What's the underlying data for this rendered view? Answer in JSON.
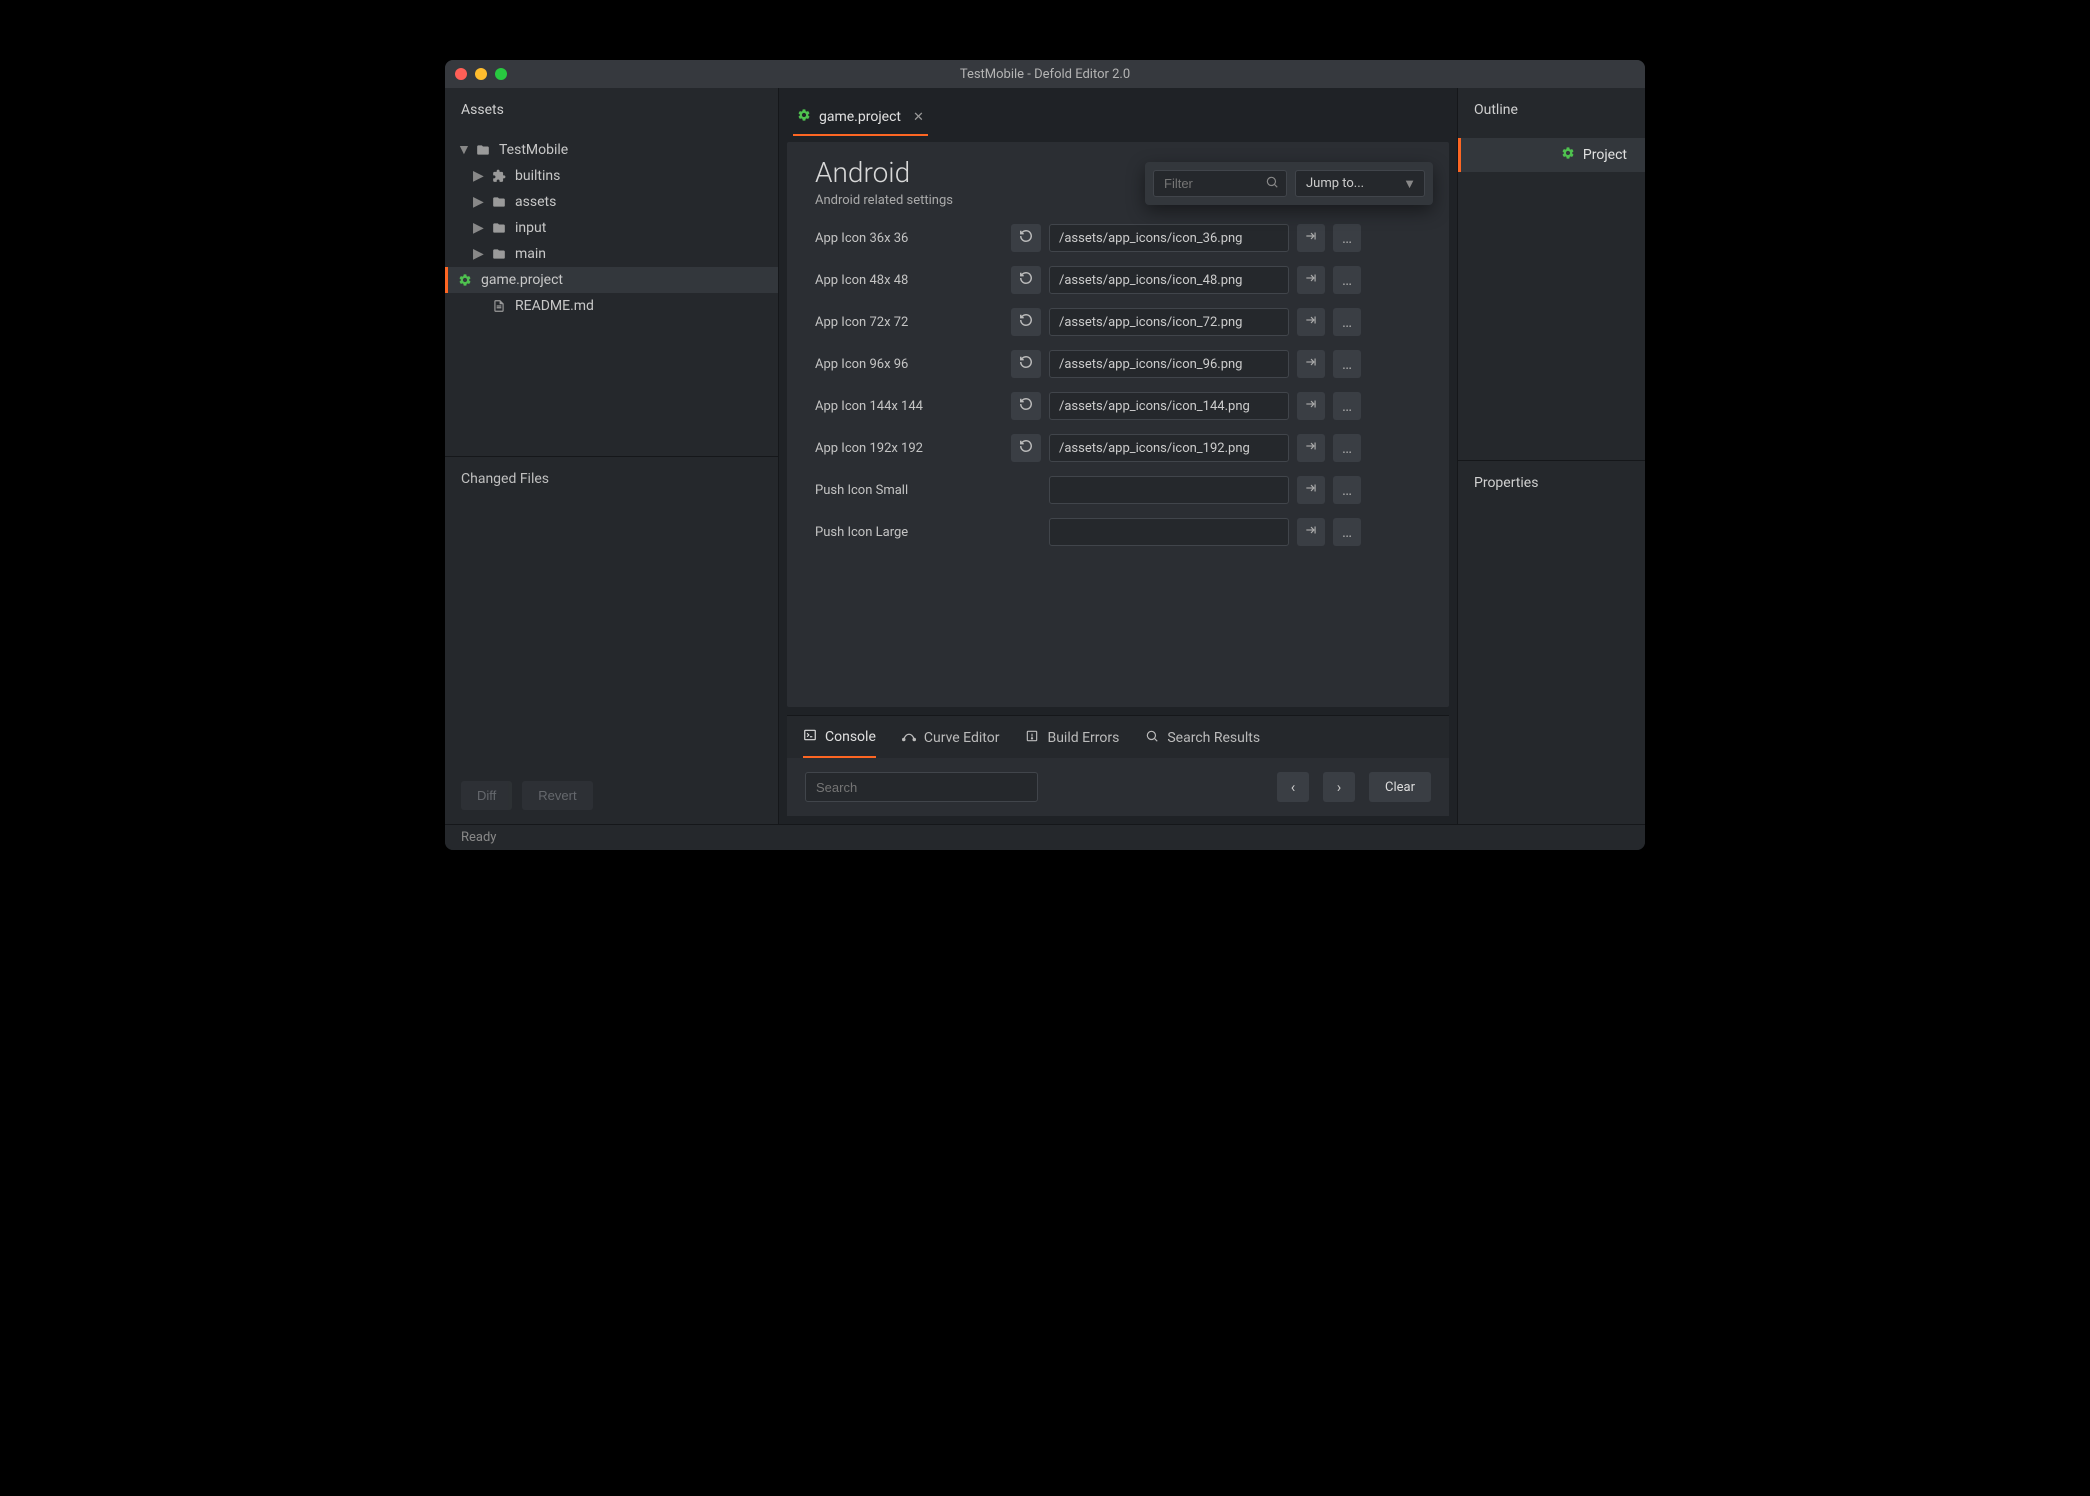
{
  "window": {
    "title": "TestMobile - Defold Editor 2.0"
  },
  "left": {
    "assets_header": "Assets",
    "tree": {
      "root": "TestMobile",
      "folders": [
        "builtins",
        "assets",
        "input",
        "main"
      ],
      "project_file": "game.project",
      "readme": "README.md"
    },
    "changed_files_header": "Changed Files",
    "diff_label": "Diff",
    "revert_label": "Revert"
  },
  "editor": {
    "tab_label": "game.project",
    "section_title": "Android",
    "section_subtitle": "Android related settings",
    "filter_placeholder": "Filter",
    "jumpto_label": "Jump to...",
    "rows": [
      {
        "label": "App Icon 36x 36",
        "value": "/assets/app_icons/icon_36.png",
        "reset": true
      },
      {
        "label": "App Icon 48x 48",
        "value": "/assets/app_icons/icon_48.png",
        "reset": true
      },
      {
        "label": "App Icon 72x 72",
        "value": "/assets/app_icons/icon_72.png",
        "reset": true
      },
      {
        "label": "App Icon 96x 96",
        "value": "/assets/app_icons/icon_96.png",
        "reset": true
      },
      {
        "label": "App Icon 144x 144",
        "value": "/assets/app_icons/icon_144.png",
        "reset": true
      },
      {
        "label": "App Icon 192x 192",
        "value": "/assets/app_icons/icon_192.png",
        "reset": true
      },
      {
        "label": "Push Icon Small",
        "value": "",
        "reset": false
      },
      {
        "label": "Push Icon Large",
        "value": "",
        "reset": false
      }
    ]
  },
  "bottom": {
    "tabs": [
      "Console",
      "Curve Editor",
      "Build Errors",
      "Search Results"
    ],
    "search_placeholder": "Search",
    "clear_label": "Clear"
  },
  "right": {
    "outline_header": "Outline",
    "outline_item": "Project",
    "properties_header": "Properties"
  },
  "status": "Ready"
}
